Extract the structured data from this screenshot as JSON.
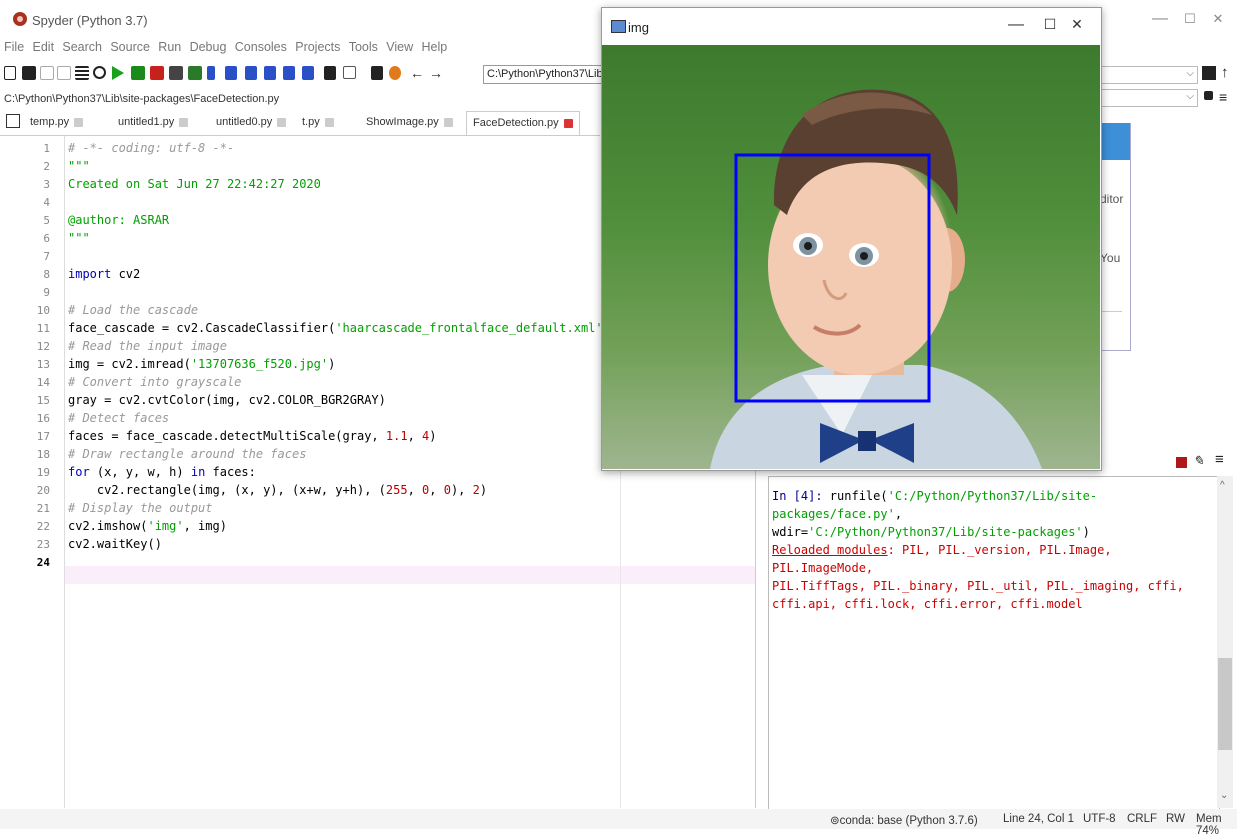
{
  "app": {
    "title": "Spyder (Python 3.7)",
    "window_controls": [
      "—",
      "☐",
      "✕"
    ]
  },
  "menu": [
    "File",
    "Edit",
    "Search",
    "Source",
    "Run",
    "Debug",
    "Consoles",
    "Projects",
    "Tools",
    "View",
    "Help"
  ],
  "toolbar": {
    "path_combo": "C:\\Python\\Python37\\Lib\\s"
  },
  "editor": {
    "filepath": "C:\\Python\\Python37\\Lib\\site-packages\\FaceDetection.py",
    "tabs": [
      "temp.py",
      "untitled1.py",
      "untitled0.py",
      "t.py",
      "ShowImage.py",
      "FaceDetection.py"
    ],
    "active_tab": "FaceDetection.py",
    "line_numbers": [
      "1",
      "2",
      "3",
      "4",
      "5",
      "6",
      "7",
      "8",
      "9",
      "10",
      "11",
      "12",
      "13",
      "14",
      "15",
      "16",
      "17",
      "18",
      "19",
      "20",
      "21",
      "22",
      "23",
      "24"
    ],
    "current_line": "24",
    "lines": {
      "l1": "# -*- coding: utf-8 -*-",
      "l2": "\"\"\"",
      "l3": "Created on Sat Jun 27 22:42:27 2020",
      "l5": "@author: ASRAR",
      "l6": "\"\"\"",
      "l8a": "import",
      "l8b": " cv2",
      "l10": "# Load the cascade",
      "l11a": "face_cascade = cv2.CascadeClassifier(",
      "l11b": "'haarcascade_frontalface_default.xml'",
      "l11c": ")",
      "l12": "# Read the input image",
      "l13a": "img = cv2.imread(",
      "l13b": "'13707636_f520.jpg'",
      "l13c": ")",
      "l14": "# Convert into grayscale",
      "l15": "gray = cv2.cvtColor(img, cv2.COLOR_BGR2GRAY)",
      "l16": "# Detect faces",
      "l17a": "faces = face_cascade.detectMultiScale(gray, ",
      "l17b": "1.1",
      "l17c": ", ",
      "l17d": "4",
      "l17e": ")",
      "l18": "# Draw rectangle around the faces",
      "l19a": "for",
      "l19b": " (x, y, w, h) ",
      "l19c": "in",
      "l19d": " faces:",
      "l20a": "    cv2.rectangle(img, (x, y), (x+w, y+h), (",
      "l20b": "255",
      "l20c": ", ",
      "l20d": "0",
      "l20e": ", ",
      "l20f": "0",
      "l20g": "), ",
      "l20h": "2",
      "l20i": ")",
      "l21": "# Display the output",
      "l22a": "cv2.imshow(",
      "l22b": "'img'",
      "l22c": ", img)",
      "l23": "cv2.waitKey()"
    }
  },
  "help_pane": {
    "text1": "ditor",
    "text2": "You"
  },
  "console": {
    "prompt": "In [4]: ",
    "cmd_a": "runfile(",
    "cmd_b": "'C:/Python/Python37/Lib/site-packages/face.py'",
    "cmd_c": ",",
    "cmd_d": "wdir=",
    "cmd_e": "'C:/Python/Python37/Lib/site-packages'",
    "cmd_f": ")",
    "reloaded_label": "Reloaded modules",
    "reloaded_list_1": ": PIL, PIL._version, PIL.Image, PIL.ImageMode,",
    "reloaded_list_2": "PIL.TiffTags, PIL._binary, PIL._util, PIL._imaging, cffi,",
    "reloaded_list_3": "cffi.api, cffi.lock, cffi.error, cffi.model"
  },
  "img_window": {
    "title": "img",
    "controls": [
      "—",
      "☐",
      "✕"
    ],
    "detection_box_color": "#0000ff"
  },
  "statusbar": {
    "conda": "⊚conda: base (Python 3.7.6)",
    "position": "Line 24, Col 1",
    "encoding": "UTF-8",
    "eol": "CRLF",
    "mode": "RW",
    "mem": "Mem 74%"
  }
}
